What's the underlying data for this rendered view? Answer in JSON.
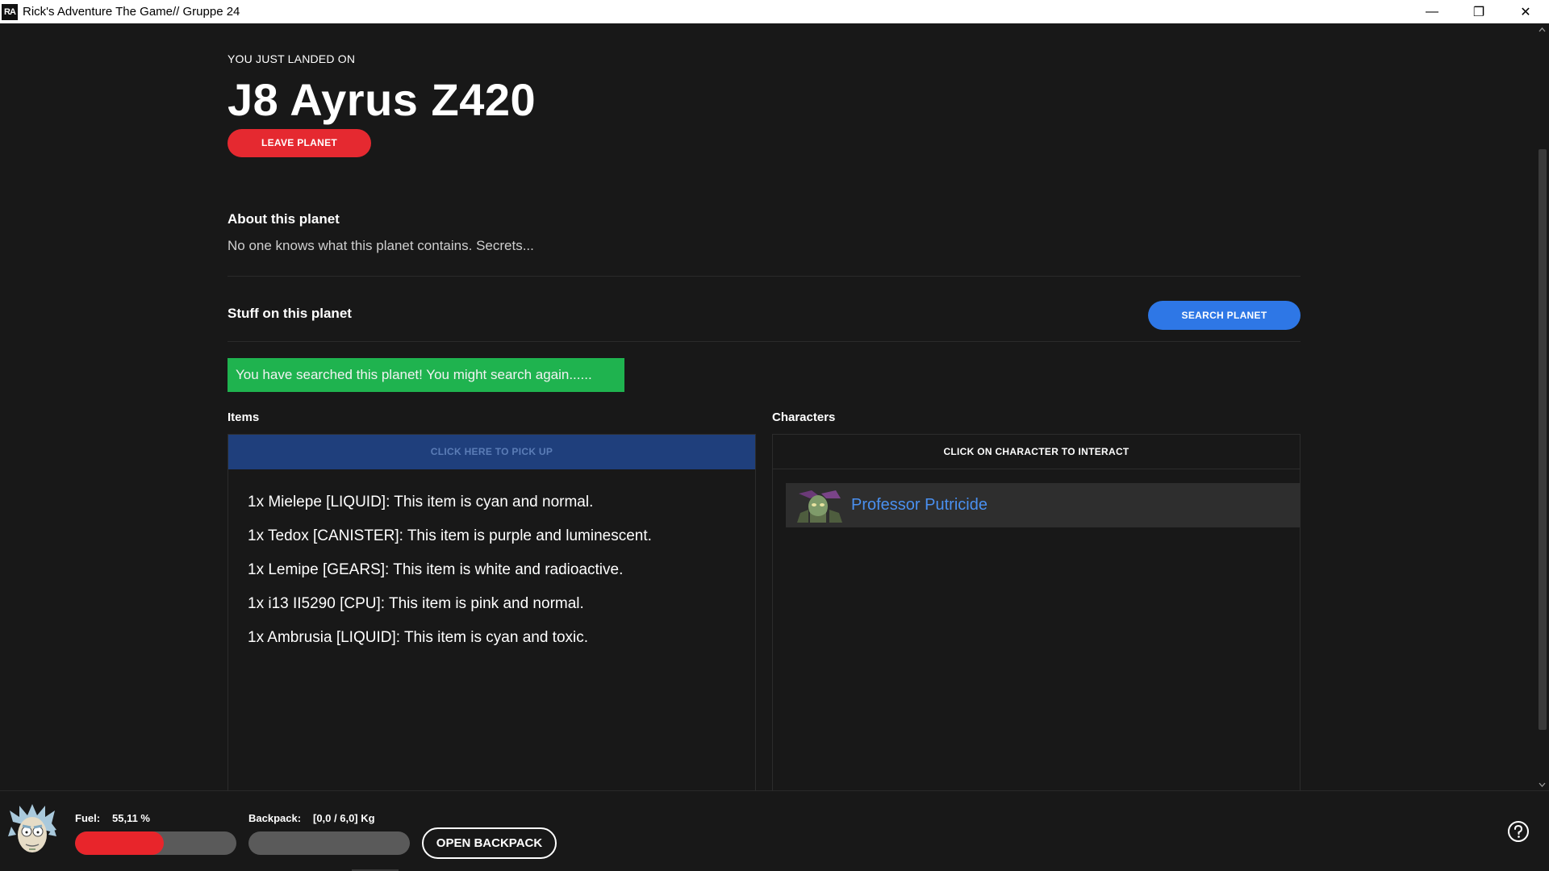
{
  "window": {
    "icon_text": "RA",
    "title": "Rick's Adventure The Game// Gruppe 24",
    "minimize": "—",
    "restore": "❐",
    "close": "✕"
  },
  "planet": {
    "landed_label": "YOU JUST LANDED ON",
    "name": "J8 Ayrus Z420",
    "leave_button": "LEAVE PLANET",
    "about_title": "About this planet",
    "about_text": "No one knows what this planet contains. Secrets..."
  },
  "stuff": {
    "title": "Stuff on this planet",
    "search_button": "SEARCH PLANET",
    "notice": "You have searched this planet! You might search again......"
  },
  "items": {
    "title": "Items",
    "pickup_bar": "CLICK HERE TO PICK UP",
    "list": [
      "1x Mielepe [LIQUID]: This item is cyan and normal.",
      "1x Tedox [CANISTER]: This item is purple and luminescent.",
      "1x Lemipe [GEARS]: This item is white and radioactive.",
      "1x i13 II5290 [CPU]: This item is pink and normal.",
      "1x Ambrusia [LIQUID]: This item is cyan and toxic."
    ]
  },
  "characters": {
    "title": "Characters",
    "interact_bar": "CLICK ON CHARACTER TO INTERACT",
    "list": [
      {
        "name": "Professor Putricide",
        "avatar": "professor-putricide-avatar"
      }
    ]
  },
  "status": {
    "fuel_label": "Fuel:",
    "fuel_value": "55,11 %",
    "fuel_fraction": 0.5511,
    "backpack_label": "Backpack:",
    "backpack_value": "[0,0 / 6,0] Kg",
    "backpack_fraction": 0.0,
    "open_backpack_button": "OPEN BACKPACK",
    "help_icon": "question-circle-icon"
  },
  "colors": {
    "background": "#181818",
    "leave_red": "#e52930",
    "search_blue": "#2e77e6",
    "notice_green": "#1fb34f",
    "pickup_bar": "#1f3f7c",
    "character_link": "#4a90f0",
    "fuel_fill": "#e8252b"
  }
}
